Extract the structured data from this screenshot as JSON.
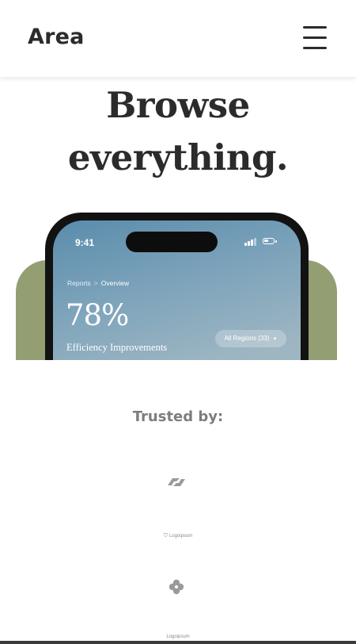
{
  "header": {
    "brand": "Area",
    "menu_icon": "hamburger-menu-icon"
  },
  "hero": {
    "title_line1": "Browse",
    "title_line2": "everything."
  },
  "phone": {
    "time": "9:41",
    "breadcrumb_parent": "Reports",
    "breadcrumb_separator": ">",
    "breadcrumb_current": "Overview",
    "metric_value": "78%",
    "metric_label": "Efficiency Improvements",
    "regions_button": "All Regions (33)"
  },
  "trusted": {
    "heading": "Trusted by:",
    "logos": [
      {
        "icon": "arrow-loop-logo-icon"
      },
      {
        "icon": "shield-logo-icon",
        "text": "Logoipsum"
      },
      {
        "icon": "clover-logo-icon"
      },
      {
        "text": "Logoipsum"
      }
    ]
  },
  "colors": {
    "accent_green": "#939e73",
    "text_dark": "#2b2b2b",
    "text_muted": "#7d7d7d",
    "sky_blue": "#7ea4bb"
  }
}
